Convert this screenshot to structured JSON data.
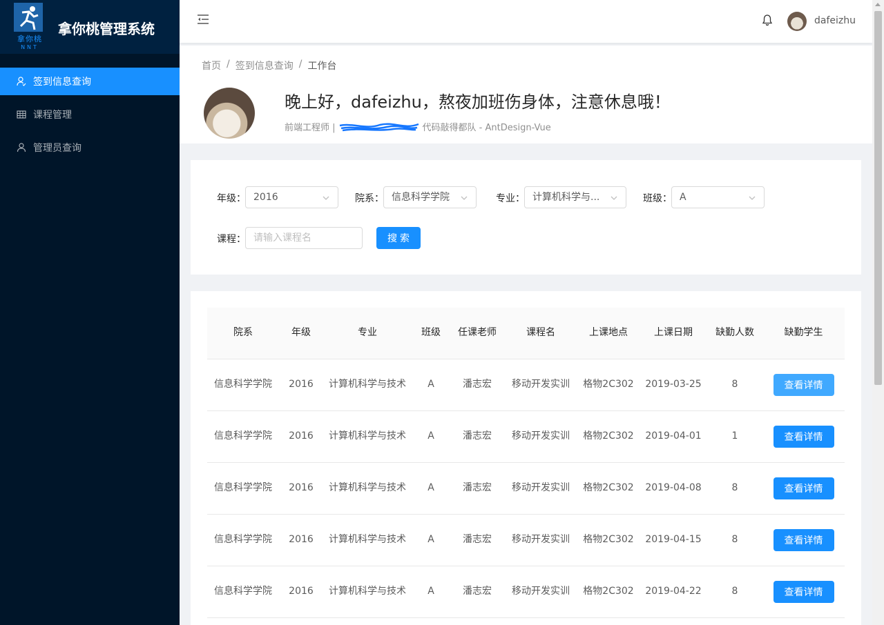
{
  "app": {
    "logo_cn": "拿你桃",
    "logo_en": "NNT",
    "title": "拿你桃管理系统"
  },
  "sidebar": {
    "items": [
      {
        "label": "签到信息查询",
        "icon": "user-check-icon"
      },
      {
        "label": "课程管理",
        "icon": "table-icon"
      },
      {
        "label": "管理员查询",
        "icon": "user-icon"
      }
    ]
  },
  "header": {
    "username": "dafeizhu"
  },
  "breadcrumb": [
    "首页",
    "签到信息查询",
    "工作台"
  ],
  "greeting": {
    "title": "晚上好，dafeizhu，熬夜加班伤身体，注意休息哦！",
    "subtitle_prefix": "前端工程师 |",
    "subtitle_suffix": "代码敲得都队 - AntDesign-Vue"
  },
  "search": {
    "grade_label": "年级：",
    "grade_value": "2016",
    "dept_label": "院系：",
    "dept_value": "信息科学学院",
    "major_label": "专业：",
    "major_value": "计算机科学与...",
    "class_label": "班级：",
    "class_value": "A",
    "course_label": "课程：",
    "course_placeholder": "请输入课程名",
    "search_button": "搜索"
  },
  "table": {
    "columns": [
      "院系",
      "年级",
      "专业",
      "班级",
      "任课老师",
      "课程名",
      "上课地点",
      "上课日期",
      "缺勤人数",
      "缺勤学生"
    ],
    "detail_button": "查看详情",
    "rows": [
      {
        "dept": "信息科学学院",
        "grade": "2016",
        "major": "计算机科学与技术",
        "class": "A",
        "teacher": "潘志宏",
        "course": "移动开发实训",
        "location": "格物2C302",
        "date": "2019-03-25",
        "absent": "8"
      },
      {
        "dept": "信息科学学院",
        "grade": "2016",
        "major": "计算机科学与技术",
        "class": "A",
        "teacher": "潘志宏",
        "course": "移动开发实训",
        "location": "格物2C302",
        "date": "2019-04-01",
        "absent": "1"
      },
      {
        "dept": "信息科学学院",
        "grade": "2016",
        "major": "计算机科学与技术",
        "class": "A",
        "teacher": "潘志宏",
        "course": "移动开发实训",
        "location": "格物2C302",
        "date": "2019-04-08",
        "absent": "8"
      },
      {
        "dept": "信息科学学院",
        "grade": "2016",
        "major": "计算机科学与技术",
        "class": "A",
        "teacher": "潘志宏",
        "course": "移动开发实训",
        "location": "格物2C302",
        "date": "2019-04-15",
        "absent": "8"
      },
      {
        "dept": "信息科学学院",
        "grade": "2016",
        "major": "计算机科学与技术",
        "class": "A",
        "teacher": "潘志宏",
        "course": "移动开发实训",
        "location": "格物2C302",
        "date": "2019-04-22",
        "absent": "8"
      }
    ]
  },
  "colors": {
    "primary": "#1890ff",
    "sidebar_bg": "#001529",
    "logo_bg": "#002140"
  }
}
